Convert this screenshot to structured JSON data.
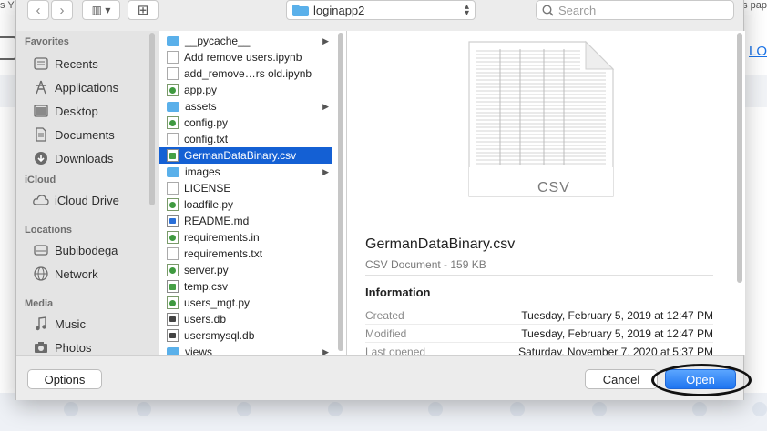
{
  "background": {
    "left_text": "s Y",
    "right_text": "s pap",
    "link_text": "LO"
  },
  "toolbar": {
    "back_label": "‹",
    "forward_label": "›",
    "view_label": "▥ ▾",
    "new_folder_label": "⊞",
    "path_name": "loginapp2",
    "search_placeholder": "Search"
  },
  "sidebar": {
    "sections": [
      {
        "title": "Favorites",
        "items": [
          {
            "label": "Recents",
            "icon": "recents-icon"
          },
          {
            "label": "Applications",
            "icon": "applications-icon"
          },
          {
            "label": "Desktop",
            "icon": "desktop-icon"
          },
          {
            "label": "Documents",
            "icon": "documents-icon"
          },
          {
            "label": "Downloads",
            "icon": "downloads-icon"
          }
        ]
      },
      {
        "title": "iCloud",
        "items": [
          {
            "label": "iCloud Drive",
            "icon": "cloud-icon"
          }
        ]
      },
      {
        "title": "Locations",
        "items": [
          {
            "label": "Bubibodega",
            "icon": "disk-icon"
          },
          {
            "label": "Network",
            "icon": "network-icon"
          }
        ]
      },
      {
        "title": "Media",
        "items": [
          {
            "label": "Music",
            "icon": "music-icon"
          },
          {
            "label": "Photos",
            "icon": "photos-icon"
          }
        ]
      }
    ]
  },
  "files": [
    {
      "name": "__pycache__",
      "type": "folder",
      "has_children": true
    },
    {
      "name": "Add remove users.ipynb",
      "type": "doc"
    },
    {
      "name": "add_remove…rs old.ipynb",
      "type": "doc"
    },
    {
      "name": "app.py",
      "type": "py"
    },
    {
      "name": "assets",
      "type": "folder",
      "has_children": true
    },
    {
      "name": "config.py",
      "type": "py"
    },
    {
      "name": "config.txt",
      "type": "doc"
    },
    {
      "name": "GermanDataBinary.csv",
      "type": "csv",
      "selected": true
    },
    {
      "name": "images",
      "type": "folder",
      "has_children": true
    },
    {
      "name": "LICENSE",
      "type": "doc"
    },
    {
      "name": "loadfile.py",
      "type": "py"
    },
    {
      "name": "README.md",
      "type": "md"
    },
    {
      "name": "requirements.in",
      "type": "py"
    },
    {
      "name": "requirements.txt",
      "type": "doc"
    },
    {
      "name": "server.py",
      "type": "py"
    },
    {
      "name": "temp.csv",
      "type": "csv"
    },
    {
      "name": "users_mgt.py",
      "type": "py"
    },
    {
      "name": "users.db",
      "type": "db"
    },
    {
      "name": "usersmysql.db",
      "type": "db"
    },
    {
      "name": "views",
      "type": "folder",
      "has_children": true
    }
  ],
  "preview": {
    "badge": "CSV",
    "file_name": "GermanDataBinary.csv",
    "kind": "CSV Document - 159 KB",
    "info_title": "Information",
    "rows": [
      {
        "key": "Created",
        "value": "Tuesday, February 5, 2019 at 12:47 PM"
      },
      {
        "key": "Modified",
        "value": "Tuesday, February 5, 2019 at 12:47 PM"
      },
      {
        "key": "Last opened",
        "value": "Saturday, November 7, 2020 at 5:37 PM"
      }
    ]
  },
  "footer": {
    "options_label": "Options",
    "cancel_label": "Cancel",
    "open_label": "Open"
  },
  "colors": {
    "selection": "#1460d4",
    "primary_button": "#1f75f0",
    "folder": "#5ab0ea"
  }
}
